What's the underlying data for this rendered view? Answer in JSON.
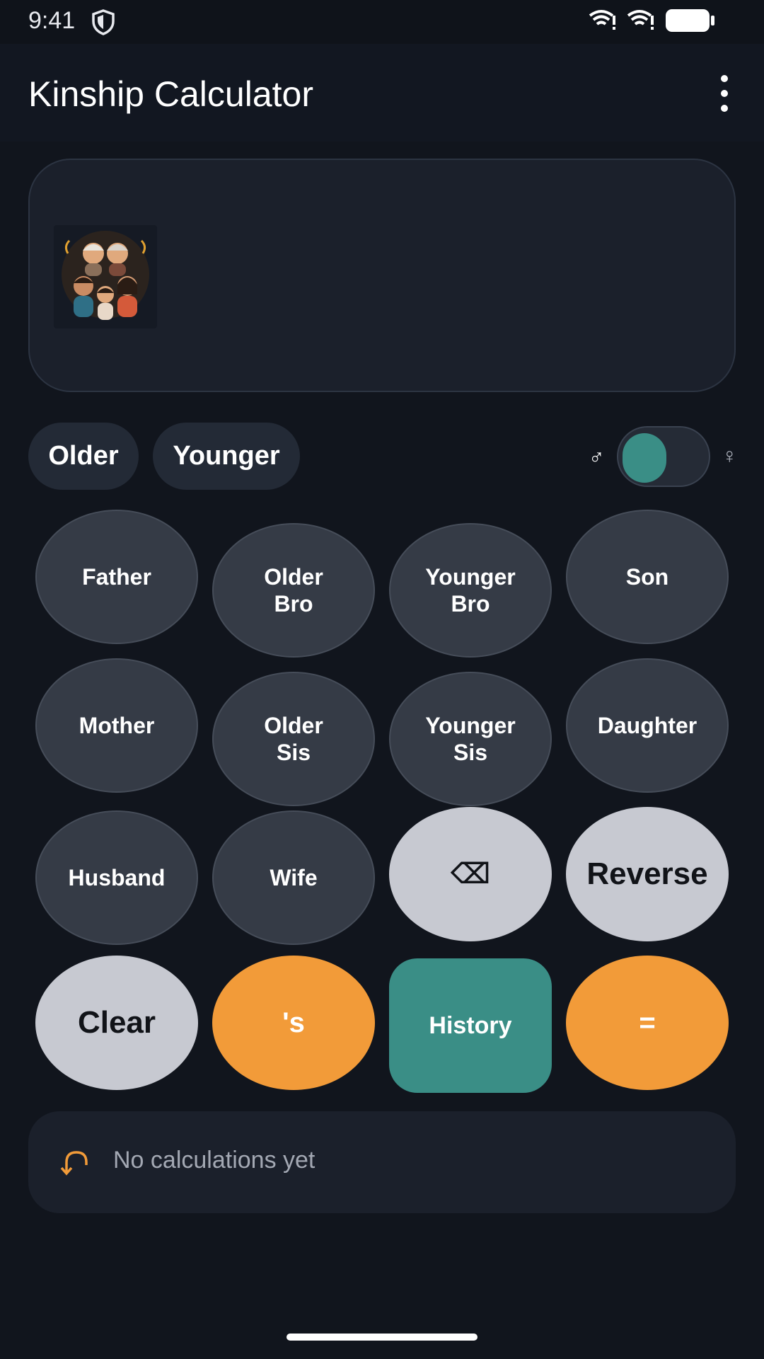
{
  "status_bar": {
    "time": "9:41"
  },
  "app_bar": {
    "title": "Kinship Calculator"
  },
  "display": {},
  "modifiers": {
    "older": "Older",
    "younger": "Younger"
  },
  "gender_toggle": {
    "male_symbol": "♂",
    "female_symbol": "♀",
    "selected": "male"
  },
  "keypad": {
    "father": "Father",
    "older_bro": "Older\nBro",
    "younger_bro": "Younger\nBro",
    "son": "Son",
    "mother": "Mother",
    "older_sis": "Older\nSis",
    "younger_sis": "Younger\nSis",
    "daughter": "Daughter",
    "husband": "Husband",
    "wife": "Wife",
    "backspace": "⌫",
    "reverse": "Reverse",
    "clear": "Clear",
    "possessive": "'s",
    "history": "History",
    "equals": "="
  },
  "history": {
    "empty_text": "No calculations yet"
  },
  "colors": {
    "accent_orange": "#f29b39",
    "accent_teal": "#3a8e86",
    "background": "#11151d"
  }
}
